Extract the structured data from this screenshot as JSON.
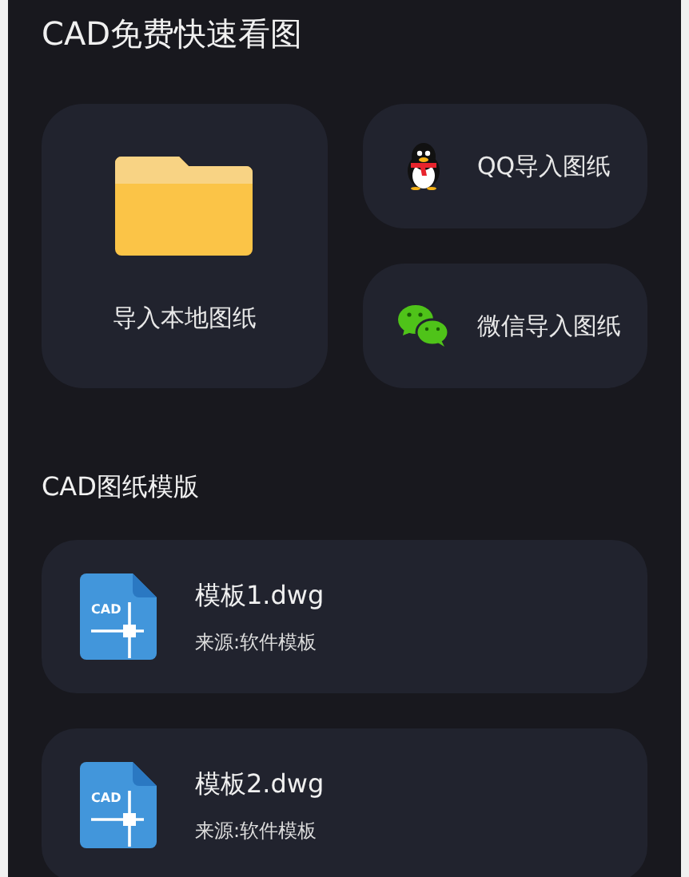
{
  "title": "CAD免费快速看图",
  "import_actions": [
    {
      "kind": "local",
      "label": "导入本地图纸"
    },
    {
      "kind": "qq",
      "label": "QQ导入图纸"
    },
    {
      "kind": "wechat",
      "label": "微信导入图纸"
    }
  ],
  "section_title": "CAD图纸模版",
  "templates": [
    {
      "icon_label": "CAD",
      "name": "模板1.dwg",
      "source": "来源:软件模板"
    },
    {
      "icon_label": "CAD",
      "name": "模板2.dwg",
      "source": "来源:软件模板"
    }
  ]
}
